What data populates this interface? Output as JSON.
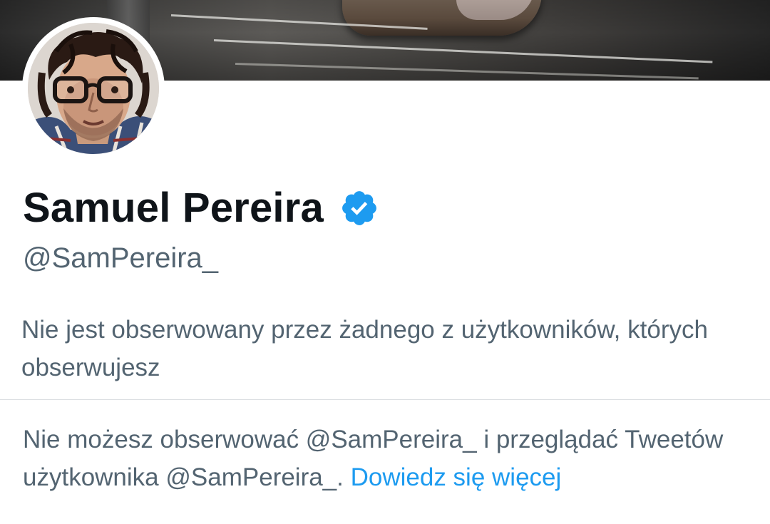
{
  "profile": {
    "display_name": "Samuel Pereira",
    "verified_icon": "verified-badge-icon",
    "handle": "@SamPereira_"
  },
  "social_context": {
    "followers_you_know": "Nie jest obserwowany przez żadnego z użytkowników, których obserwujesz"
  },
  "protected_notice": {
    "text": "Nie możesz obserwować @SamPereira_ i przeglądać Tweetów użytkownika @SamPereira_.",
    "link_label": "Dowiedz się więcej"
  },
  "colors": {
    "primary_text": "#0f1419",
    "secondary_text": "#536471",
    "accent": "#1d9bf0",
    "divider": "#dcdfe2"
  }
}
